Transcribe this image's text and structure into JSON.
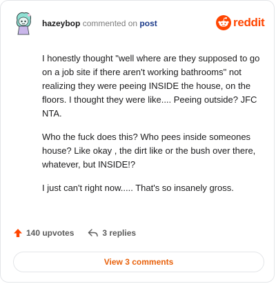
{
  "header": {
    "username": "hazeybop",
    "action_text": "commented on",
    "post_link": "post",
    "brand": "reddit"
  },
  "comment": {
    "paragraphs": [
      "I honestly thought \"well where are they supposed to go on a job site if there aren't working bathrooms\" not realizing they were peeing INSIDE the house, on the floors. I thought they were like.... Peeing outside? JFC NTA.",
      "Who the fuck does this? Who pees inside someones house? Like okay , the dirt like or the bush over there, whatever, but INSIDE!?",
      "I just can't right now..... That's so insanely gross."
    ]
  },
  "actions": {
    "upvotes": "140 upvotes",
    "replies": "3 replies"
  },
  "view_comments": "View 3 comments",
  "colors": {
    "brand": "#ff4500",
    "upvote": "#ff4500",
    "view_button_text": "#e8610b",
    "post_link": "#1b3a8a"
  },
  "icons": {
    "upvote": "arrow-up-icon",
    "reply": "reply-arrow-icon",
    "brand": "reddit-snoo-icon",
    "avatar": "snoo-avatar"
  }
}
